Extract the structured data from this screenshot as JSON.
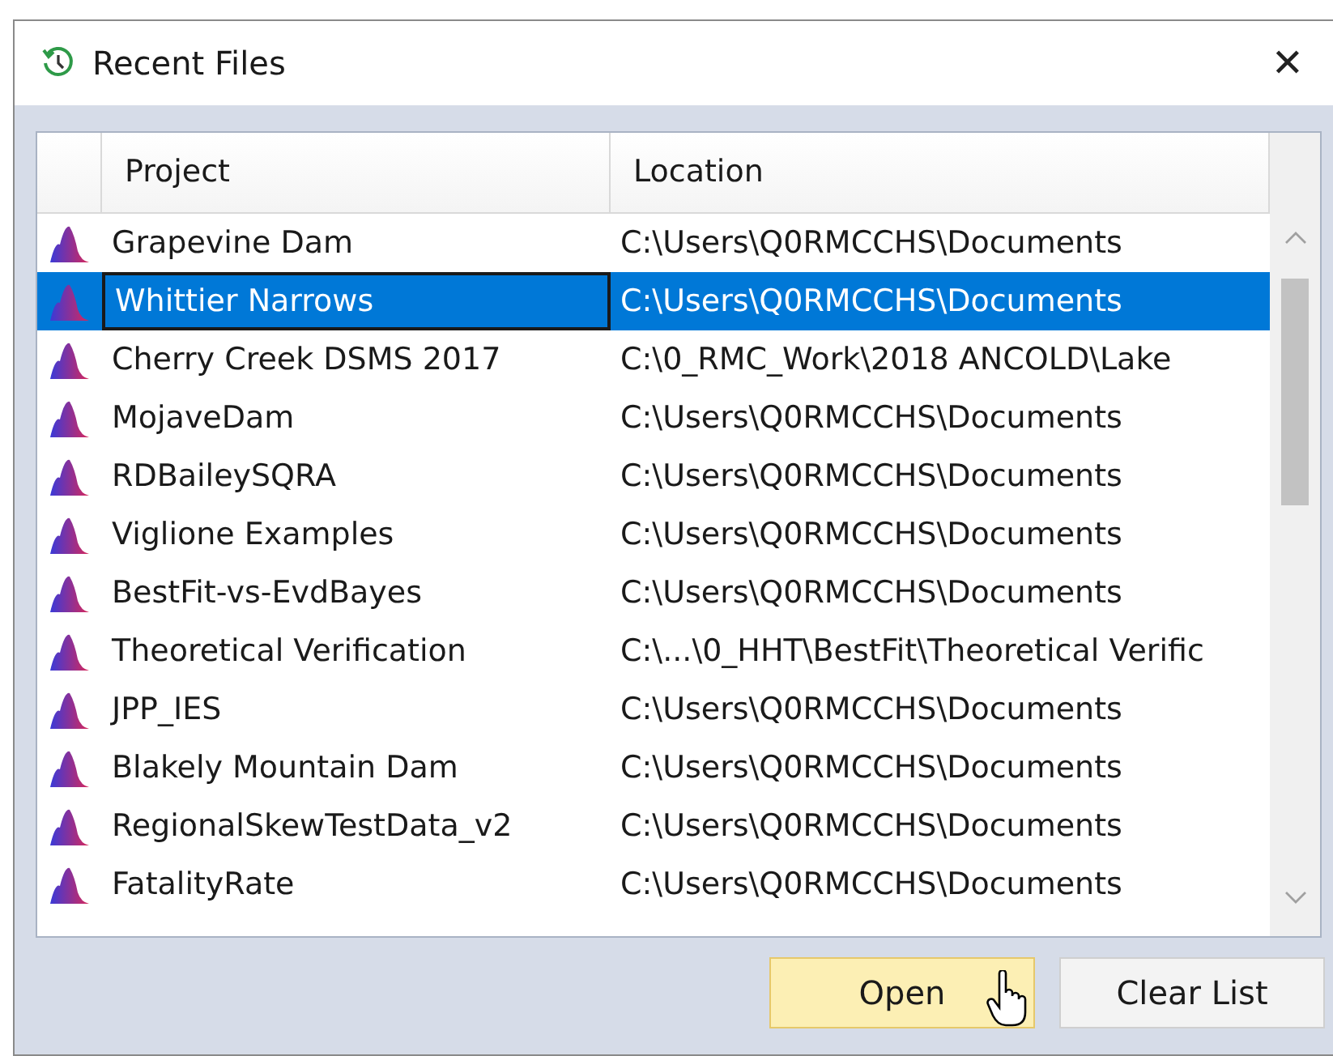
{
  "window": {
    "title": "Recent Files",
    "close": "✕"
  },
  "table": {
    "columns": [
      "Project",
      "Location"
    ],
    "rows": [
      {
        "project": "Grapevine Dam",
        "location": "C:\\Users\\Q0RMCCHS\\Documents",
        "selected": false
      },
      {
        "project": "Whittier Narrows",
        "location": "C:\\Users\\Q0RMCCHS\\Documents",
        "selected": true
      },
      {
        "project": "Cherry Creek DSMS 2017",
        "location": "C:\\0_RMC_Work\\2018 ANCOLD\\Lake",
        "selected": false
      },
      {
        "project": "MojaveDam",
        "location": "C:\\Users\\Q0RMCCHS\\Documents",
        "selected": false
      },
      {
        "project": "RDBaileySQRA",
        "location": "C:\\Users\\Q0RMCCHS\\Documents",
        "selected": false
      },
      {
        "project": "Viglione Examples",
        "location": "C:\\Users\\Q0RMCCHS\\Documents",
        "selected": false
      },
      {
        "project": "BestFit-vs-EvdBayes",
        "location": "C:\\Users\\Q0RMCCHS\\Documents",
        "selected": false
      },
      {
        "project": "Theoretical Verification",
        "location": "C:\\...\\0_HHT\\BestFit\\Theoretical Verific",
        "selected": false
      },
      {
        "project": "JPP_IES",
        "location": "C:\\Users\\Q0RMCCHS\\Documents",
        "selected": false
      },
      {
        "project": "Blakely Mountain Dam",
        "location": "C:\\Users\\Q0RMCCHS\\Documents",
        "selected": false
      },
      {
        "project": "RegionalSkewTestData_v2",
        "location": "C:\\Users\\Q0RMCCHS\\Documents",
        "selected": false
      },
      {
        "project": "FatalityRate",
        "location": "C:\\Users\\Q0RMCCHS\\Documents",
        "selected": false
      }
    ]
  },
  "buttons": [
    {
      "label": "Open",
      "kind": "hover"
    },
    {
      "label": "Clear List",
      "kind": "normal"
    }
  ]
}
